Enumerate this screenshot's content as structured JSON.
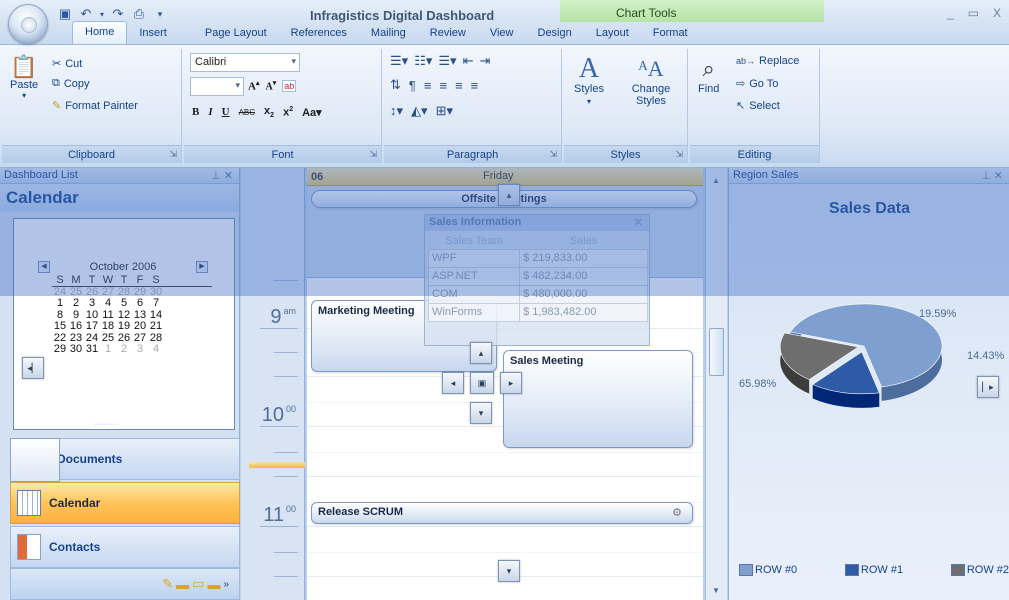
{
  "window": {
    "title": "Infragistics Digital Dashboard",
    "context_tab_group": "Chart Tools",
    "controls": [
      "_",
      "▭",
      "X"
    ]
  },
  "quick_access": [
    "save-icon",
    "undo-icon",
    "dropdown-icon",
    "redo-icon",
    "print-icon",
    "customize-icon"
  ],
  "tabs": [
    "Home",
    "Insert",
    "Page Layout",
    "References",
    "Mailing",
    "Review",
    "View",
    "Design",
    "Layout",
    "Format"
  ],
  "active_tab": "Home",
  "ribbon": {
    "clipboard": {
      "label": "Clipboard",
      "paste": "Paste",
      "cut": "Cut",
      "copy": "Copy",
      "format_painter": "Format Painter"
    },
    "font": {
      "label": "Font",
      "family": "Calibri",
      "size": "",
      "bold": "B",
      "italic": "I",
      "underline": "U"
    },
    "paragraph": {
      "label": "Paragraph"
    },
    "styles": {
      "label": "Styles",
      "styles_btn": "Styles",
      "change_styles": "Change Styles"
    },
    "editing": {
      "label": "Editing",
      "find": "Find",
      "replace": "Replace",
      "goto": "Go To",
      "select": "Select"
    }
  },
  "left_panel": {
    "title": "Dashboard List",
    "section": "Calendar",
    "month_label": "October 2006",
    "weekdays": [
      "S",
      "M",
      "T",
      "W",
      "T",
      "F",
      "S"
    ],
    "weeks": [
      [
        "24",
        "25",
        "26",
        "27",
        "28",
        "29",
        "30"
      ],
      [
        "1",
        "2",
        "3",
        "4",
        "5",
        "6",
        "7"
      ],
      [
        "8",
        "9",
        "10",
        "11",
        "12",
        "13",
        "14"
      ],
      [
        "15",
        "16",
        "17",
        "18",
        "19",
        "20",
        "21"
      ],
      [
        "22",
        "23",
        "24",
        "25",
        "26",
        "27",
        "28"
      ],
      [
        "29",
        "30",
        "31",
        "1",
        "2",
        "3",
        "4"
      ]
    ],
    "nav": [
      {
        "label": "Documents",
        "active": false
      },
      {
        "label": "Calendar",
        "active": true
      },
      {
        "label": "Contacts",
        "active": false
      }
    ]
  },
  "day_view": {
    "day_number": "06",
    "day_name": "Friday",
    "hours": [
      {
        "hour": "9",
        "suffix": "am"
      },
      {
        "hour": "10",
        "suffix": "00"
      },
      {
        "hour": "11",
        "suffix": "00"
      }
    ],
    "all_day_event": "Offsite Meetings",
    "appointments": [
      "Marketing Meeting",
      "Sales Meeting",
      "Release SCRUM"
    ]
  },
  "sales_popup": {
    "title": "Sales Information",
    "columns": [
      "Sales Team",
      "Sales"
    ],
    "rows": [
      [
        "WPF",
        "$ 219,833.00"
      ],
      [
        "ASP.NET",
        "$ 482,234.00"
      ],
      [
        "COM",
        "$ 480,000.00"
      ],
      [
        "WinForms",
        "$ 1,983,482.00"
      ]
    ]
  },
  "right_panel": {
    "title": "Region Sales",
    "chart_title": "Sales Data"
  },
  "chart_data": {
    "type": "pie",
    "title": "Sales Data",
    "categories": [
      "ROW #0",
      "ROW #1",
      "ROW #2"
    ],
    "values": [
      65.98,
      14.43,
      19.59
    ],
    "labels": [
      "65.98%",
      "14.43%",
      "19.59%"
    ],
    "colors": [
      "#7f9fd0",
      "#2e5aa8",
      "#6e6e6e"
    ],
    "legend": "bottom"
  }
}
